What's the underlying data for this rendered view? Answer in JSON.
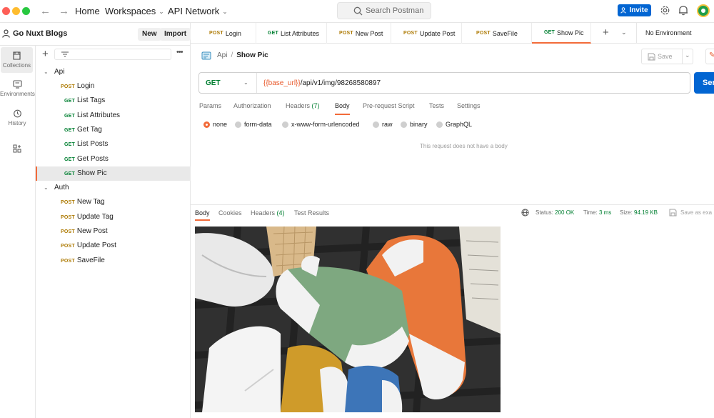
{
  "topbar": {
    "home": "Home",
    "workspaces": "Workspaces",
    "api_network": "API Network",
    "search_placeholder": "Search Postman",
    "invite": "Invite"
  },
  "workspace": {
    "name": "Go Nuxt Blogs",
    "new_label": "New",
    "import_label": "Import"
  },
  "rail": {
    "collections": "Collections",
    "environments": "Environments",
    "history": "History"
  },
  "tree": {
    "api_folder": "Api",
    "api_items": [
      {
        "method": "POST",
        "label": "Login"
      },
      {
        "method": "GET",
        "label": "List Tags"
      },
      {
        "method": "GET",
        "label": "List Attributes"
      },
      {
        "method": "GET",
        "label": "Get Tag"
      },
      {
        "method": "GET",
        "label": "List Posts"
      },
      {
        "method": "GET",
        "label": "Get Posts"
      },
      {
        "method": "GET",
        "label": "Show Pic"
      }
    ],
    "auth_folder": "Auth",
    "auth_items": [
      {
        "method": "POST",
        "label": "New Tag"
      },
      {
        "method": "POST",
        "label": "Update Tag"
      },
      {
        "method": "POST",
        "label": "New Post"
      },
      {
        "method": "POST",
        "label": "Update Post"
      },
      {
        "method": "POST",
        "label": "SaveFile"
      }
    ]
  },
  "tabs": [
    {
      "method": "POST",
      "label": "Login"
    },
    {
      "method": "GET",
      "label": "List Attributes"
    },
    {
      "method": "POST",
      "label": "New Post"
    },
    {
      "method": "POST",
      "label": "Update Post"
    },
    {
      "method": "POST",
      "label": "SaveFile"
    },
    {
      "method": "GET",
      "label": "Show Pic"
    }
  ],
  "environment": "No Environment",
  "request": {
    "breadcrumb_parent": "Api",
    "breadcrumb_sep": "/",
    "breadcrumb_current": "Show Pic",
    "save_label": "Save",
    "method": "GET",
    "url_var": "{{base_url}}",
    "url_path": "/api/v1/img/98268580897",
    "send_label": "Ser",
    "tabs": {
      "params": "Params",
      "authorization": "Authorization",
      "headers": "Headers",
      "headers_count": "(7)",
      "body": "Body",
      "prerequest": "Pre-request Script",
      "tests": "Tests",
      "settings": "Settings"
    },
    "body_types": {
      "none": "none",
      "form_data": "form-data",
      "urlencoded": "x-www-form-urlencoded",
      "raw": "raw",
      "binary": "binary",
      "graphql": "GraphQL"
    },
    "no_body_msg": "This request does not have a body"
  },
  "response": {
    "tabs": {
      "body": "Body",
      "cookies": "Cookies",
      "headers": "Headers",
      "headers_count": "(4)",
      "test_results": "Test Results"
    },
    "status_label": "Status:",
    "status_value": "200 OK",
    "time_label": "Time:",
    "time_value": "3 ms",
    "size_label": "Size:",
    "size_value": "94.19 KB",
    "save_example": "Save as exa"
  },
  "colors": {
    "accent": "#f26b3a",
    "primary": "#0265d2",
    "get": "#007f31",
    "post": "#ad7a03"
  }
}
